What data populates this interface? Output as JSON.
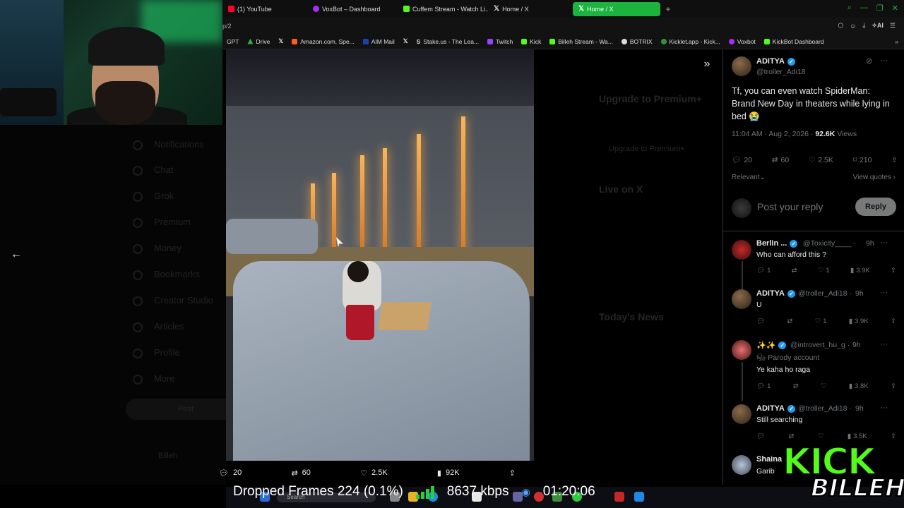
{
  "browser": {
    "tabs": [
      {
        "label": "(1) YouTube",
        "color": "#ff0033"
      },
      {
        "label": "VoxBot – Dashboard",
        "color": "#a62df5"
      },
      {
        "label": "Cuffem Stream - Watch Li...",
        "color": "#53fc18"
      },
      {
        "label": "Home / X",
        "color": "#ffffff"
      },
      {
        "label": "Home / X",
        "color": "#ffffff",
        "active": true
      }
    ],
    "address_fragment": "p/2",
    "ai_label": "AI",
    "bookmarks": [
      {
        "label": "GPT",
        "color": "#10a37f"
      },
      {
        "label": "Drive",
        "color": "#34a853"
      },
      {
        "label": "",
        "color": "#ffffff"
      },
      {
        "label": "Amazon.com. Spe...",
        "color": "#ff9900"
      },
      {
        "label": "AIM Mail",
        "color": "#1e40af"
      },
      {
        "label": "",
        "color": "#ffffff"
      },
      {
        "label": "Stake.us - The Lea...",
        "color": "#1a2c38"
      },
      {
        "label": "Twitch",
        "color": "#9146ff"
      },
      {
        "label": "Kick",
        "color": "#53fc18"
      },
      {
        "label": "Billeh Stream - Wa...",
        "color": "#53fc18"
      },
      {
        "label": "BOTRIX",
        "color": "#dddddd"
      },
      {
        "label": "Kicklet.app - Kick...",
        "color": "#3b8f3b"
      },
      {
        "label": "Voxbot",
        "color": "#a62df5"
      },
      {
        "label": "KickBot Dashboard",
        "color": "#53fc18"
      }
    ]
  },
  "left_nav": {
    "items": [
      "Notifications",
      "Chat",
      "Grok",
      "Premium",
      "Money",
      "Bookmarks",
      "Creator Studio",
      "Articles",
      "Profile",
      "More"
    ],
    "post_label": "Post",
    "account": "Billeh"
  },
  "middle_ghost": {
    "premium_title": "Upgrade to Premium+",
    "premium_button": "Upgrade to Premium+",
    "live_title": "Live on X",
    "news_title": "Today's News"
  },
  "media_actions": {
    "replies": "20",
    "reposts": "60",
    "likes": "2.5K",
    "views": "92K"
  },
  "post": {
    "author": "ADITYA",
    "handle": "@troller_Adi18",
    "text": "Tf, you can even watch SpiderMan: Brand New Day in theaters while lying in bed 😭",
    "time": "11:04 AM · Aug 2, 2026 · ",
    "views_count": "92.6K",
    "views_label": " Views",
    "replies": "20",
    "reposts": "60",
    "likes": "2.5K",
    "bookmarks": "210",
    "sort_label": "Relevant",
    "view_quotes": "View quotes",
    "reply_placeholder": "Post your reply",
    "reply_button": "Reply"
  },
  "replies": [
    {
      "name": "Berlin ...",
      "handle": "@Toxicity____ ·",
      "time": "9h",
      "text": "Who can afford this ?",
      "reply_count": "1",
      "repost_count": "",
      "like_count": "1",
      "views": "3.9K"
    },
    {
      "name": "ADITYA",
      "handle": "@troller_Adi18 ·",
      "time": "9h",
      "text": "U",
      "reply_count": "",
      "repost_count": "",
      "like_count": "1",
      "views": "3.9K"
    },
    {
      "name": "✨✨",
      "handle": "@introvert_hu_g ·",
      "time": "9h",
      "parody": "Parody account",
      "text": "Ye kaha ho raga",
      "reply_count": "1",
      "repost_count": "",
      "like_count": "",
      "views": "3.8K"
    },
    {
      "name": "ADITYA",
      "handle": "@troller_Adi18 ·",
      "time": "9h",
      "text": "Still searching",
      "reply_count": "",
      "repost_count": "",
      "like_count": "",
      "views": "3.5K"
    },
    {
      "name": "Shaina",
      "handle": "",
      "time": "",
      "text": "Garib",
      "reply_count": "",
      "repost_count": "",
      "like_count": "",
      "views": ""
    }
  ],
  "stream_overlay": {
    "dropped_frames": "Dropped Frames 224 (0.1%)",
    "bitrate": "8637 kbps",
    "uptime": "01:20:06",
    "logo_top": "KICK",
    "logo_bottom": "BILLEH"
  },
  "taskbar": {
    "search_placeholder": "Search"
  }
}
